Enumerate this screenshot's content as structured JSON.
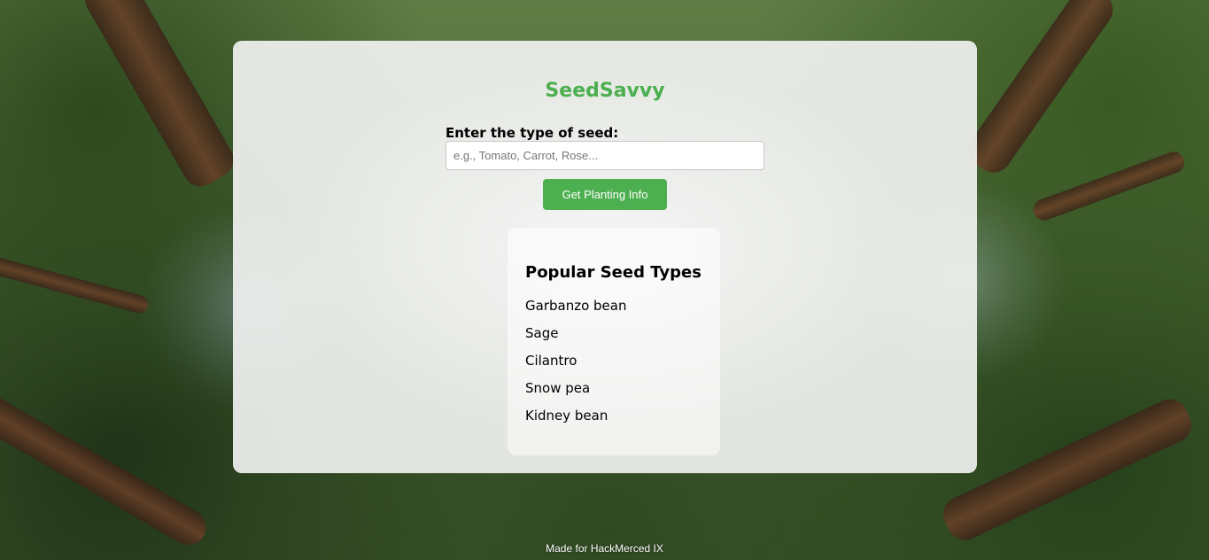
{
  "app": {
    "title": "SeedSavvy"
  },
  "search": {
    "label": "Enter the type of seed:",
    "placeholder": "e.g., Tomato, Carrot, Rose...",
    "value": "",
    "button_label": "Get Planting Info"
  },
  "popular": {
    "heading": "Popular Seed Types",
    "items": [
      "Garbanzo bean",
      "Sage",
      "Cilantro",
      "Snow pea",
      "Kidney bean"
    ]
  },
  "footer": {
    "text": "Made for HackMerced IX"
  },
  "colors": {
    "accent": "#4caf50",
    "card_background": "#f5f5f5"
  }
}
